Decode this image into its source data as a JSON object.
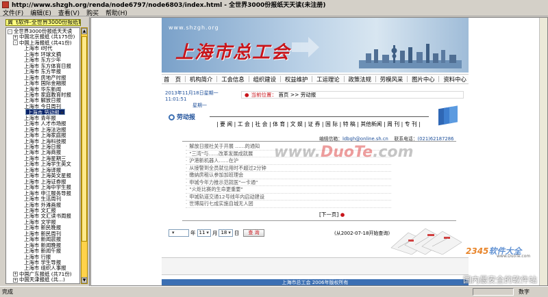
{
  "window": {
    "title": "http://www.shzgh.org/renda/node6797/node6803/index.html - 全世界3000份报纸天天读(未注册)"
  },
  "menu": [
    "文件(F)",
    "编辑(E)",
    "查看(V)",
    "购买",
    "帮助(H)"
  ],
  "left": {
    "header": "翼飞软件-全世界3000份报纸软件",
    "tree": [
      {
        "label": "全世界3000份报纸天天读",
        "level": 0,
        "pm": "-"
      },
      {
        "label": "中国北京报纸 (共175份)",
        "level": 1,
        "pm": "+"
      },
      {
        "label": "中国上海报纸 (共41份)",
        "level": 1,
        "pm": "-"
      },
      {
        "label": "上海市 I时代",
        "level": 2
      },
      {
        "label": "上海市 环球文摘",
        "level": 2
      },
      {
        "label": "上海市 东方少年",
        "level": 2
      },
      {
        "label": "上海市 东方体育日报",
        "level": 2
      },
      {
        "label": "上海市 东方早报",
        "level": 2
      },
      {
        "label": "上海市 房地产时报",
        "level": 2
      },
      {
        "label": "上海市 国际金融报",
        "level": 2
      },
      {
        "label": "上海市 华东新闻",
        "level": 2
      },
      {
        "label": "上海市 家庭教育时报",
        "level": 2
      },
      {
        "label": "上海市 解放日报",
        "level": 2
      },
      {
        "label": "上海市 今日周刊",
        "level": 2
      },
      {
        "label": "上海市 劳动报",
        "level": 2,
        "selected": true
      },
      {
        "label": "上海市 青年报",
        "level": 2
      },
      {
        "label": "上海市 人才市场报",
        "level": 2
      },
      {
        "label": "上海市 上海法治报",
        "level": 2
      },
      {
        "label": "上海市 上海家庭报",
        "level": 2
      },
      {
        "label": "上海市 上海科技报",
        "level": 2
      },
      {
        "label": "上海市 上海日报",
        "level": 2
      },
      {
        "label": "上海市 上海商报",
        "level": 2
      },
      {
        "label": "上海市 上海星期三",
        "level": 2
      },
      {
        "label": "上海市 上海学生英文",
        "level": 2
      },
      {
        "label": "上海市 上海译报",
        "level": 2
      },
      {
        "label": "上海市 上海英文星报",
        "level": 2
      },
      {
        "label": "上海市 上海证券报",
        "level": 2
      },
      {
        "label": "上海市 上海中学生报",
        "level": 2
      },
      {
        "label": "上海市 申江服务导报",
        "level": 2
      },
      {
        "label": "上海市 生活周刊",
        "level": 2
      },
      {
        "label": "上海市 外滩画报",
        "level": 2
      },
      {
        "label": "上海市 文汇报",
        "level": 2
      },
      {
        "label": "上海市 文汇读书周报",
        "level": 2
      },
      {
        "label": "上海市 文学报",
        "level": 2
      },
      {
        "label": "上海市 新民晚报",
        "level": 2
      },
      {
        "label": "上海市 新民周刊",
        "level": 2
      },
      {
        "label": "上海市 新闻晨报",
        "level": 2
      },
      {
        "label": "上海市 新闻晚报",
        "level": 2
      },
      {
        "label": "上海市 新闻午报",
        "level": 2
      },
      {
        "label": "上海市 行报",
        "level": 2
      },
      {
        "label": "上海市 学生导报",
        "level": 2
      },
      {
        "label": "上海市 组织人事报",
        "level": 2
      },
      {
        "label": "中国广东报纸 (共71份)",
        "level": 1,
        "pm": "+"
      },
      {
        "label": "中国天津报纸 (共...)",
        "level": 1,
        "pm": "+"
      }
    ]
  },
  "site": {
    "banner_url": "www.shzgh.org",
    "logo": "上海市总工会",
    "nav": [
      "首　页",
      "机构简介",
      "工会信息",
      "组织建设",
      "权益维护",
      "工运理论",
      "政策法规",
      "劳模风采",
      "图片中心",
      "资料中心"
    ],
    "date_line1": "2013年11月18日星期一 11:01:51",
    "date_line2": "星期一",
    "location_label": "当前位置：",
    "location_path": "首页 >> 劳动报",
    "section_title": "劳动报",
    "categories": "| 要 闻 | 工 会 | 社 会 | 体 育 | 文 娱 | 证 券 | 国 际 | 特 稿 | 其他新闻 | 周 刊 | 专 刊 |",
    "contact_email_label": "编辑信箱：",
    "contact_email": "ldbgh@online.sh.cn",
    "contact_phone_label": "联系电话：",
    "contact_phone": "(021)62187286",
    "news": [
      "解放日报社关于开展 ……的通知",
      "\"三湾\"与……改革发展成就展",
      "沪港新机器人……在沪",
      "从接警到全员就位用时不超过2分钟",
      "缴纳房租认参加加班理会",
      "申城今年力推示范就医\"一卡通\"",
      "\"火炬比赛的生命更重要\"",
      "申城轨道交通12号线年内启动建设",
      "世博局行七成实施自城无人团"
    ],
    "next_page": "[下一页]",
    "search": {
      "year_value": "",
      "year_label": "年",
      "month_value": "11",
      "month_label": "月",
      "day_value": "18",
      "day_label": "日",
      "button": "查 询",
      "hint": "(从2002-07-18开始查询)"
    },
    "copyright": "上海市总工会 2006年版权所有"
  },
  "watermarks": {
    "w1_a": "www.",
    "w1_b": "DuoTe",
    "w1_c": ".com",
    "w2_num": "2345",
    "w2_text": "软件大全",
    "w3": "www.DuoTe.com",
    "w4": "国内最安全的软件站"
  },
  "status": {
    "text": "完成",
    "zone": "数字"
  }
}
